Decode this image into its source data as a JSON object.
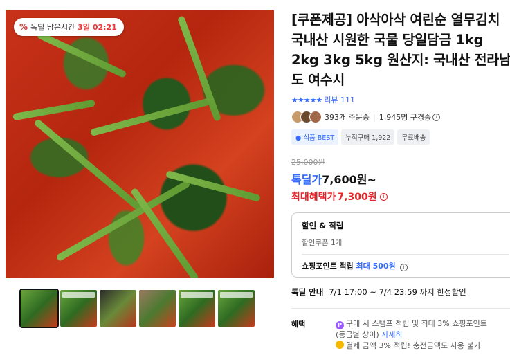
{
  "image": {
    "badge_prefix": "독딜 남은시간",
    "badge_time": "3일 02:21",
    "badge_icon": "percent-icon"
  },
  "thumbnails": [
    {
      "label": "thumb-1"
    },
    {
      "label": "thumb-2"
    },
    {
      "label": "thumb-3"
    },
    {
      "label": "thumb-4"
    },
    {
      "label": "thumb-5"
    },
    {
      "label": "thumb-6"
    }
  ],
  "product": {
    "title": "[쿠폰제공] 아삭아삭 여린순 열무김치 국내산 시원한 국물 당일담금 1kg 2kg 3kg 5kg 원산지: 국내산 전라남도 여수시",
    "review_label": "리뷰 111",
    "stars": "★★★★★",
    "orders": "393개 주문중",
    "buyers": "1,945명 구경중",
    "tags": [
      "식품 BEST",
      "누적구매 1,922",
      "무료배송"
    ],
    "original_price": "25,000원",
    "sale_label": "톡딜가",
    "sale_price": "7,600원~",
    "max_label": "최대혜택가",
    "max_price": "7,300원"
  },
  "benefits": {
    "title": "할인 & 적립",
    "coupon": "할인쿠폰 1개",
    "point_prefix": "쇼핑포인트 적립",
    "point_highlight": "최대 500원"
  },
  "deal": {
    "label": "톡딜 안내",
    "value": "7/1 17:00 ~ 7/4 23:59 까지 한정할인"
  },
  "perks": {
    "label": "혜택",
    "line1": "구매 시 스탬프 적립 및 최대 3% 쇼핑포인트",
    "line2": "(등급별 상이)",
    "line2_link": "자세히",
    "line3": "결제 금액 3% 적립! 충전금액도 사용 불가"
  },
  "colors": {
    "accent_blue": "#346aff",
    "price_red": "#e52528"
  }
}
